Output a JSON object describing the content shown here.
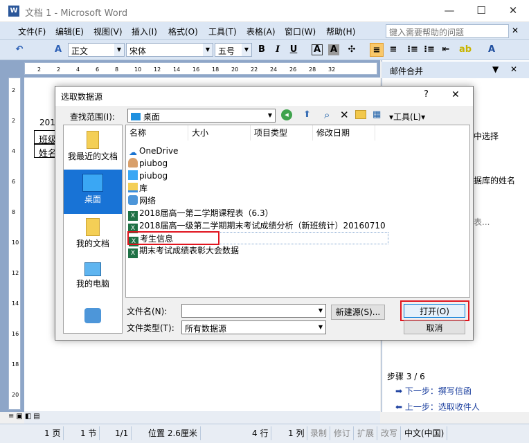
{
  "window": {
    "title": "文档 1 - Microsoft Word",
    "min": "—",
    "max": "☐",
    "close": "✕"
  },
  "menu": [
    "文件(F)",
    "编辑(E)",
    "视图(V)",
    "插入(I)",
    "格式(O)",
    "工具(T)",
    "表格(A)",
    "窗口(W)",
    "帮助(H)"
  ],
  "help_placeholder": "键入需要帮助的问题",
  "toolbar": {
    "style": "正文",
    "font": "宋体",
    "size": "五号",
    "bold": "B",
    "italic": "I",
    "underline": "U"
  },
  "ruler_ticks": [
    "2",
    "2",
    "4",
    "6",
    "8",
    "10",
    "12",
    "14",
    "16",
    "18",
    "20",
    "22",
    "24",
    "26",
    "28",
    "32"
  ],
  "vruler_ticks": [
    "2",
    "2",
    "4",
    "6",
    "8",
    "10",
    "12",
    "14",
    "16",
    "18",
    "20"
  ],
  "doc": {
    "year": "201",
    "row1": "班级",
    "row2": "姓名"
  },
  "pane": {
    "title": "邮件合并",
    "text1": "中选择",
    "text2": "据库的姓名",
    "text3": "表...",
    "step": "步骤 3 / 6",
    "next": "下一步：撰写信函",
    "prev": "上一步：选取收件人"
  },
  "dialog": {
    "title": "选取数据源",
    "help": "?",
    "close": "✕",
    "lookin_label": "查找范围(I):",
    "lookin_value": "桌面",
    "tools_label": "工具(L)",
    "places": [
      "我最近的文档",
      "桌面",
      "我的文档",
      "我的电脑"
    ],
    "columns": [
      "名称",
      "大小",
      "项目类型",
      "修改日期"
    ],
    "files": [
      "OneDrive",
      "piubog",
      "piubog",
      "库",
      "网络",
      "2018届高一第二学期课程表（6.3）",
      "2018届高一级第二学期期末考试成绩分析（新班统计）20160710",
      "考生信息",
      "期末考试成绩表彰大会数据"
    ],
    "filename_label": "文件名(N):",
    "filename_value": "",
    "filetype_label": "文件类型(T):",
    "filetype_value": "所有数据源",
    "newsource_button": "新建源(S)...",
    "open_button": "打开(O)",
    "cancel_button": "取消"
  },
  "status": {
    "page": "1 页",
    "section": "1 节",
    "pages": "1/1",
    "position": "位置 2.6厘米",
    "line": "4 行",
    "col": "1 列",
    "rec": "录制",
    "rev": "修订",
    "ext": "扩展",
    "ovr": "改写",
    "lang": "中文(中国)"
  },
  "colors": {
    "accent": "#e0141e",
    "menu_bg": "#dbe6f4",
    "doc_bg": "#8ea6c8"
  }
}
